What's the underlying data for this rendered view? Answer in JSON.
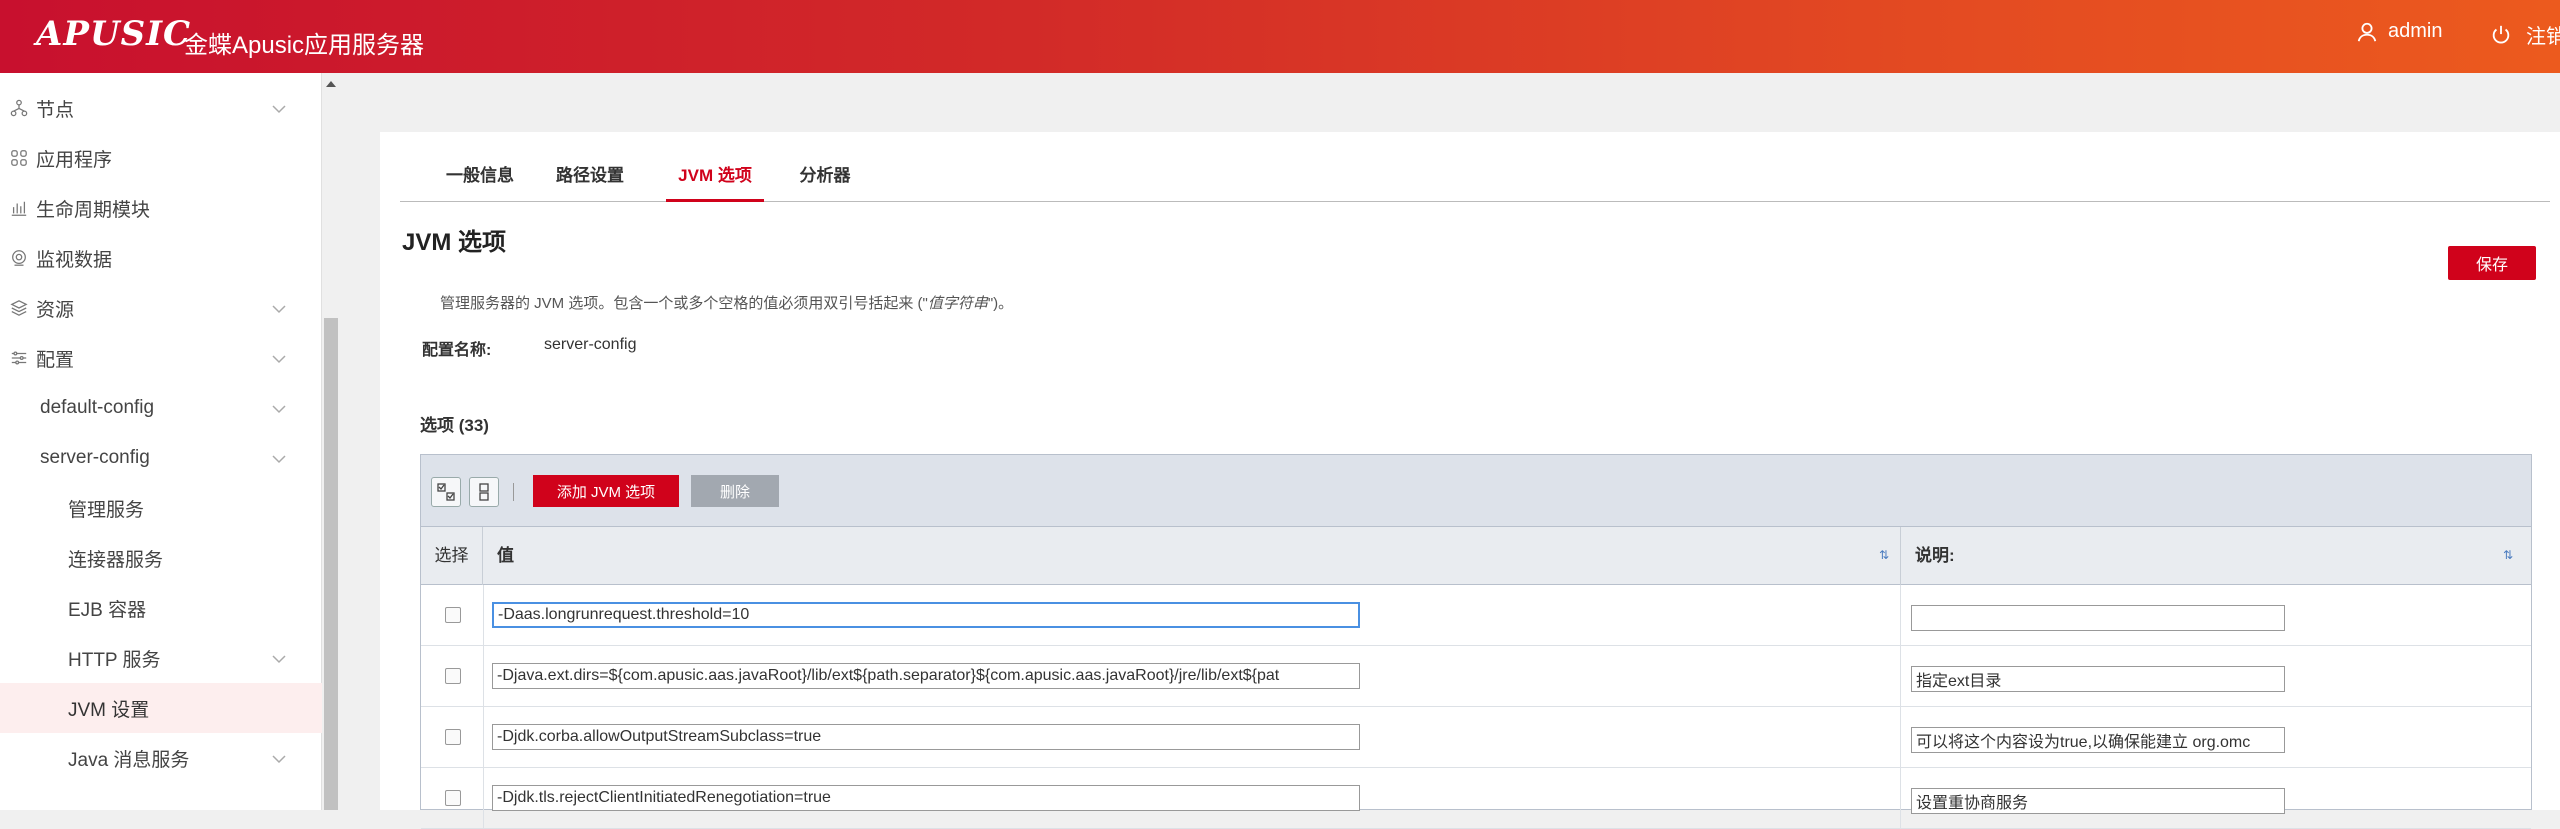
{
  "header": {
    "logo": "APUSIC",
    "title": "金蝶Apusic应用服务器",
    "user": "admin",
    "logout": "注销"
  },
  "sidebar": {
    "items": [
      {
        "label": "节点",
        "icon": "node-icon",
        "chevron": true
      },
      {
        "label": "应用程序",
        "icon": "apps-icon",
        "chevron": false
      },
      {
        "label": "生命周期模块",
        "icon": "lifecycle-icon",
        "chevron": false
      },
      {
        "label": "监视数据",
        "icon": "monitor-icon",
        "chevron": false
      },
      {
        "label": "资源",
        "icon": "resource-icon",
        "chevron": true
      },
      {
        "label": "配置",
        "icon": "config-icon",
        "chevron": true
      },
      {
        "label": "default-config",
        "chevron": true
      },
      {
        "label": "server-config",
        "chevron": true
      },
      {
        "label": "管理服务",
        "chevron": false
      },
      {
        "label": "连接器服务",
        "chevron": false
      },
      {
        "label": "EJB 容器",
        "chevron": false
      },
      {
        "label": "HTTP 服务",
        "chevron": true
      },
      {
        "label": "JVM 设置",
        "chevron": false,
        "active": true
      },
      {
        "label": "Java 消息服务",
        "chevron": true
      }
    ]
  },
  "tabs": [
    {
      "label": "一般信息"
    },
    {
      "label": "路径设置"
    },
    {
      "label": "JVM 选项",
      "active": true
    },
    {
      "label": "分析器"
    }
  ],
  "page": {
    "title": "JVM 选项",
    "save_label": "保存",
    "description": "管理服务器的 JVM 选项。包含一个或多个空格的值必须用双引号括起来 (\"",
    "description_em": "值字符串",
    "description_end": "\")。",
    "config_name_label": "配置名称:",
    "config_name_value": "server-config",
    "options_title": "选项 (33)"
  },
  "table": {
    "add_label": "添加 JVM 选项",
    "delete_label": "删除",
    "columns": {
      "select": "选择",
      "value": "值",
      "note": "说明:"
    },
    "rows": [
      {
        "value": "-Daas.longrunrequest.threshold=10",
        "note": ""
      },
      {
        "value": "-Djava.ext.dirs=${com.apusic.aas.javaRoot}/lib/ext${path.separator}${com.apusic.aas.javaRoot}/jre/lib/ext${pat",
        "note": "指定ext目录"
      },
      {
        "value": "-Djdk.corba.allowOutputStreamSubclass=true",
        "note": "可以将这个内容设为true,以确保能建立 org.omc"
      },
      {
        "value": "-Djdk.tls.rejectClientInitiatedRenegotiation=true",
        "note": "设置重协商服务"
      }
    ]
  },
  "colors": {
    "brand": "#d0021b",
    "header_start": "#c8102e",
    "header_end": "#ec5a1e"
  }
}
